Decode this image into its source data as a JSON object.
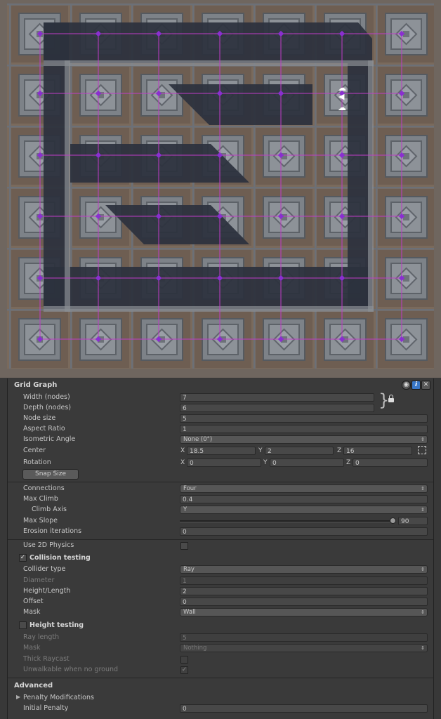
{
  "panel": {
    "title": "Grid Graph",
    "icons": [
      "eye-icon",
      "info-icon",
      "close-icon"
    ],
    "width_label": "Width (nodes)",
    "width_value": "7",
    "depth_label": "Depth (nodes)",
    "depth_value": "6",
    "node_size_label": "Node size",
    "node_size_value": "5",
    "aspect_label": "Aspect Ratio",
    "aspect_value": "1",
    "iso_label": "Isometric Angle",
    "iso_value": "None (0°)",
    "center_label": "Center",
    "center": {
      "x_label": "X",
      "x": "18.5",
      "y_label": "Y",
      "y": "2",
      "z_label": "Z",
      "z": "16"
    },
    "rotation_label": "Rotation",
    "rotation": {
      "x_label": "X",
      "x": "0",
      "y_label": "Y",
      "y": "0",
      "z_label": "Z",
      "z": "0"
    },
    "snap_label": "Snap Size",
    "connections_label": "Connections",
    "connections_value": "Four",
    "max_climb_label": "Max Climb",
    "max_climb_value": "0.4",
    "climb_axis_label": "Climb Axis",
    "climb_axis_value": "Y",
    "max_slope_label": "Max Slope",
    "max_slope_value": "90",
    "max_slope_fraction": 1.0,
    "erosion_label": "Erosion iterations",
    "erosion_value": "0",
    "use2d_label": "Use 2D Physics",
    "use2d_checked": false,
    "collision_label": "Collision testing",
    "collision_checked": true,
    "collider_label": "Collider type",
    "collider_value": "Ray",
    "diameter_label": "Diameter",
    "diameter_value": "1",
    "height_length_label": "Height/Length",
    "height_length_value": "2",
    "offset_label": "Offset",
    "offset_value": "0",
    "mask_label": "Mask",
    "mask_value": "Wall",
    "height_testing_label": "Height testing",
    "height_testing_checked": false,
    "ray_length_label": "Ray length",
    "ray_length_value": "5",
    "mask2_label": "Mask",
    "mask2_value": "Nothing",
    "thick_label": "Thick Raycast",
    "thick_checked": false,
    "unwalkable_label": "Unwalkable when no ground",
    "unwalkable_checked": true,
    "advanced_label": "Advanced",
    "penalty_mod_label": "Penalty Modifications",
    "initial_penalty_label": "Initial Penalty",
    "initial_penalty_value": "0",
    "arrow_char": "▶",
    "check_char": "✓",
    "updown_char": "⇕",
    "brace_char": "}",
    "lock_char": "🔒"
  },
  "scene": {
    "grid_color": "#c03cc8",
    "node_color": "#8a2fd0",
    "wall_color": "#2c313d"
  }
}
